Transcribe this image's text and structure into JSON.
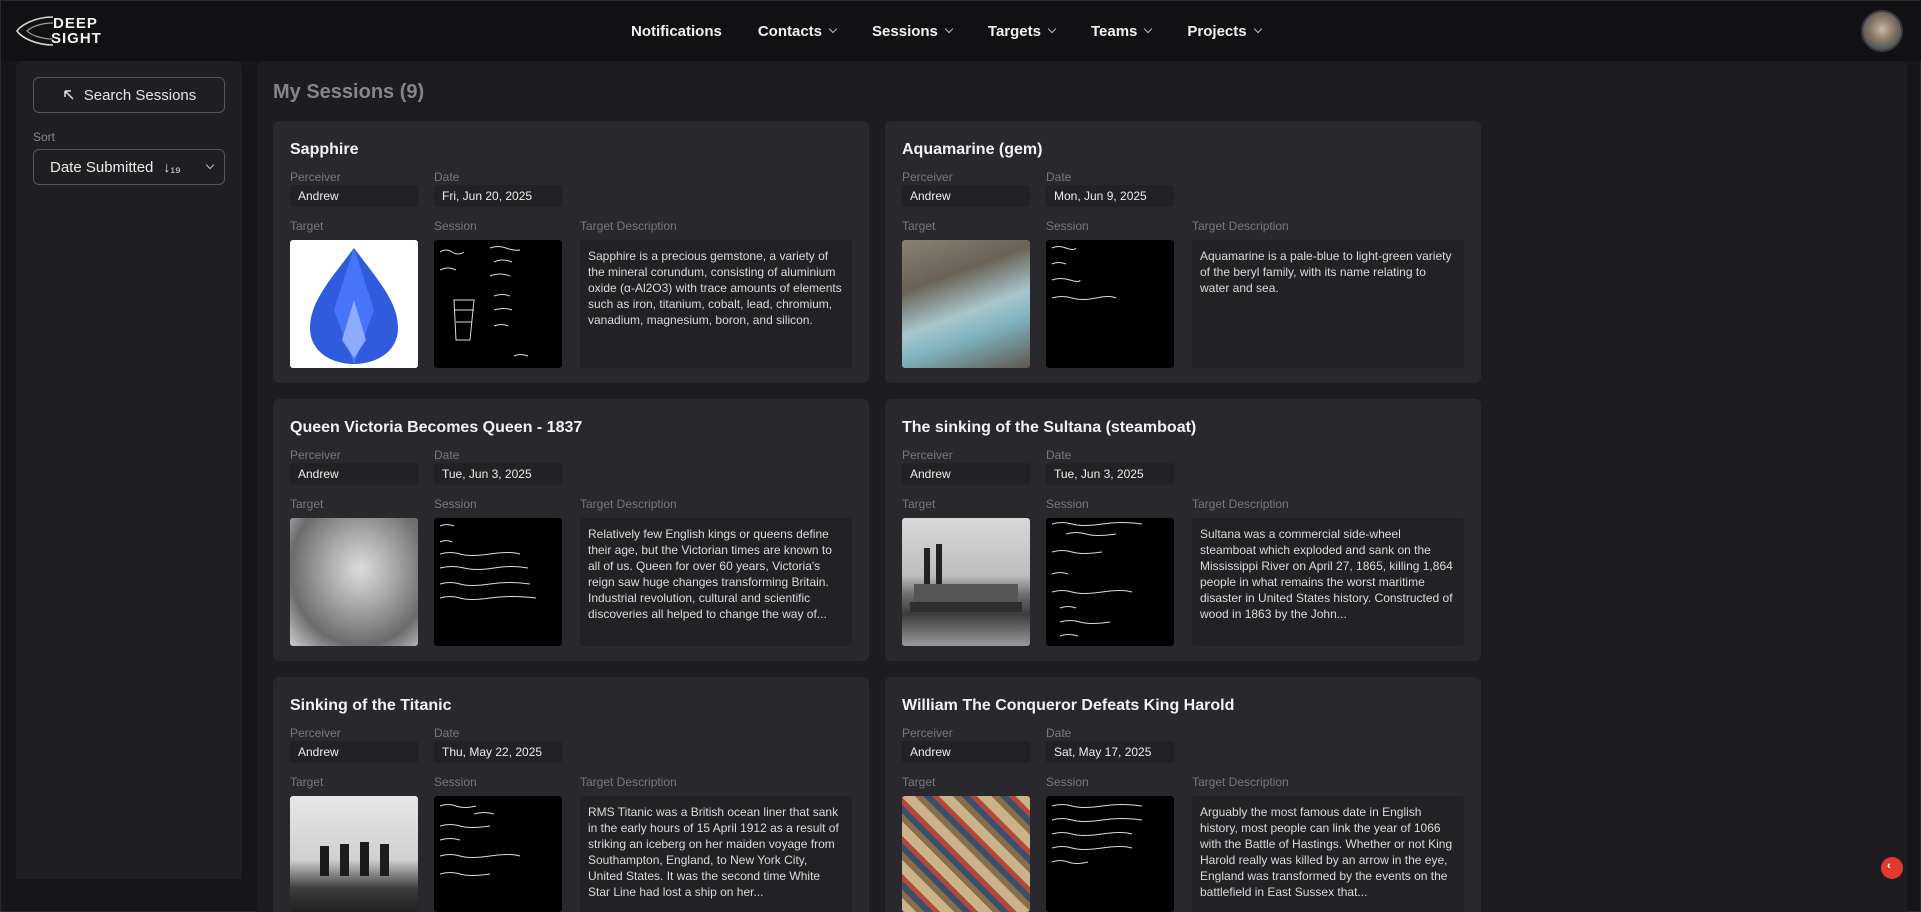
{
  "logo": {
    "line1": "DEEP",
    "line2": "SIGHT"
  },
  "nav": {
    "items": [
      {
        "label": "Notifications",
        "dropdown": false
      },
      {
        "label": "Contacts",
        "dropdown": true
      },
      {
        "label": "Sessions",
        "dropdown": true
      },
      {
        "label": "Targets",
        "dropdown": true
      },
      {
        "label": "Teams",
        "dropdown": true
      },
      {
        "label": "Projects",
        "dropdown": true
      }
    ]
  },
  "sidebar": {
    "search_label": "Search Sessions",
    "sort_label": "Sort",
    "sort_value": "Date Submitted",
    "sort_icon": "↓₁₉"
  },
  "main": {
    "title": "My Sessions (9)",
    "labels": {
      "perceiver": "Perceiver",
      "date": "Date",
      "target": "Target",
      "session": "Session",
      "description": "Target Description"
    },
    "sessions": [
      {
        "title": "Sapphire",
        "perceiver": "Andrew",
        "date": "Fri, Jun 20, 2025",
        "description": "Sapphire is a precious gemstone, a variety of the mineral corundum, consisting of aluminium oxide (α-Al2O3) with trace amounts of elements such as iron, titanium, cobalt, lead, chromium, vanadium, magnesium, boron, and silicon."
      },
      {
        "title": "Aquamarine (gem)",
        "perceiver": "Andrew",
        "date": "Mon, Jun 9, 2025",
        "description": "Aquamarine is a pale-blue to light-green variety of the beryl family, with its name relating to water and sea."
      },
      {
        "title": "Queen Victoria Becomes Queen - 1837",
        "perceiver": "Andrew",
        "date": "Tue, Jun 3, 2025",
        "description": "Relatively few English kings or queens define their age, but the Victorian times are known to all of us. Queen for over 60 years, Victoria's reign saw huge changes transforming Britain. Industrial revolution, cultural and scientific discoveries all helped to change the way of..."
      },
      {
        "title": "The sinking of the Sultana (steamboat)",
        "perceiver": "Andrew",
        "date": "Tue, Jun 3, 2025",
        "description": "Sultana was a commercial side-wheel steamboat which exploded and sank on the Mississippi River on April 27, 1865, killing 1,864 people in what remains the worst maritime disaster in United States history. Constructed of wood in 1863 by the John..."
      },
      {
        "title": "Sinking of the Titanic",
        "perceiver": "Andrew",
        "date": "Thu, May 22, 2025",
        "description": "RMS Titanic was a British ocean liner that sank in the early hours of 15 April 1912 as a result of striking an iceberg on her maiden voyage from Southampton, England, to New York City, United States. It was the second time White Star Line had lost a ship on her..."
      },
      {
        "title": "William The Conqueror Defeats King Harold",
        "perceiver": "Andrew",
        "date": "Sat, May 17, 2025",
        "description": "Arguably the most famous date in English history, most people can link the year of 1066 with the Battle of Hastings. Whether or not King Harold really was killed by an arrow in the eye, England was transformed by the events on the battlefield in East Sussex that..."
      }
    ]
  }
}
